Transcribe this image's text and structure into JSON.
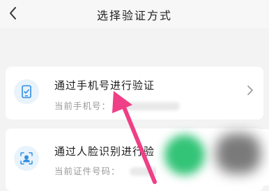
{
  "header": {
    "title": "选择验证方式",
    "back_icon": "chevron-left-icon"
  },
  "options": [
    {
      "label": "通过手机号进行验证",
      "sublabel": "当前手机号：",
      "icon": "phone-icon"
    },
    {
      "label": "通过人脸识别进行验",
      "sublabel": "当前证件号码：",
      "icon": "face-scan-icon"
    }
  ],
  "colors": {
    "accent": "#2f8de4",
    "icon_bg": "#e8f3fb",
    "annotation_arrow": "#ef3f86",
    "page_bg": "#f3f3f3"
  }
}
